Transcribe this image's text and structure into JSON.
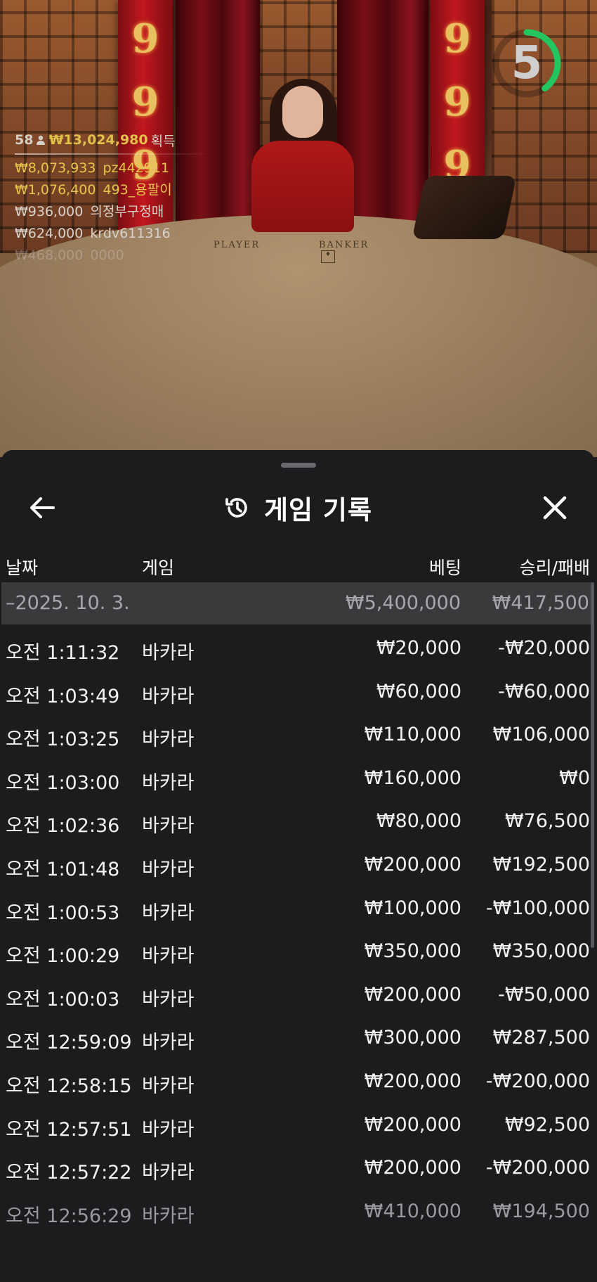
{
  "video": {
    "timer_value": "5",
    "timer_progress": 0.4,
    "table_labels": {
      "player": "PLAYER",
      "banker": "BANKER"
    },
    "pillar_digit": "9",
    "leaderboard": {
      "count": "58",
      "total": "₩13,024,980",
      "total_suffix": "획득",
      "rows": [
        {
          "amount": "₩8,073,933",
          "name": "pz442911"
        },
        {
          "amount": "₩1,076,400",
          "name": "493_용팔이"
        },
        {
          "amount": "₩936,000",
          "name": "의정부구정매"
        },
        {
          "amount": "₩624,000",
          "name": "krdv611316"
        },
        {
          "amount": "₩468,000",
          "name": "0000"
        }
      ]
    }
  },
  "panel": {
    "title": "게임 기록",
    "columns": {
      "date": "날짜",
      "game": "게임",
      "bet": "베팅",
      "winloss": "승리/패배"
    },
    "date_group": {
      "label": "–2025. 10. 3.",
      "bet": "₩5,400,000",
      "winloss": "₩417,500"
    },
    "rows": [
      {
        "time": "오전 1:11:32",
        "game": "바카라",
        "bet": "₩20,000",
        "winloss": "-₩20,000"
      },
      {
        "time": "오전 1:03:49",
        "game": "바카라",
        "bet": "₩60,000",
        "winloss": "-₩60,000"
      },
      {
        "time": "오전 1:03:25",
        "game": "바카라",
        "bet": "₩110,000",
        "winloss": "₩106,000"
      },
      {
        "time": "오전 1:03:00",
        "game": "바카라",
        "bet": "₩160,000",
        "winloss": "₩0"
      },
      {
        "time": "오전 1:02:36",
        "game": "바카라",
        "bet": "₩80,000",
        "winloss": "₩76,500"
      },
      {
        "time": "오전 1:01:48",
        "game": "바카라",
        "bet": "₩200,000",
        "winloss": "₩192,500"
      },
      {
        "time": "오전 1:00:53",
        "game": "바카라",
        "bet": "₩100,000",
        "winloss": "-₩100,000"
      },
      {
        "time": "오전 1:00:29",
        "game": "바카라",
        "bet": "₩350,000",
        "winloss": "₩350,000"
      },
      {
        "time": "오전 1:00:03",
        "game": "바카라",
        "bet": "₩200,000",
        "winloss": "-₩50,000"
      },
      {
        "time": "오전 12:59:09",
        "game": "바카라",
        "bet": "₩300,000",
        "winloss": "₩287,500"
      },
      {
        "time": "오전 12:58:15",
        "game": "바카라",
        "bet": "₩200,000",
        "winloss": "-₩200,000"
      },
      {
        "time": "오전 12:57:51",
        "game": "바카라",
        "bet": "₩200,000",
        "winloss": "₩92,500"
      },
      {
        "time": "오전 12:57:22",
        "game": "바카라",
        "bet": "₩200,000",
        "winloss": "-₩200,000"
      },
      {
        "time": "오전 12:56:29",
        "game": "바카라",
        "bet": "₩410,000",
        "winloss": "₩194,500"
      }
    ]
  },
  "colors": {
    "gold": "#e6c64c",
    "timer_green": "#22c55e",
    "panel_bg": "#1c1c1e",
    "date_row_bg": "#3a3a3c"
  }
}
